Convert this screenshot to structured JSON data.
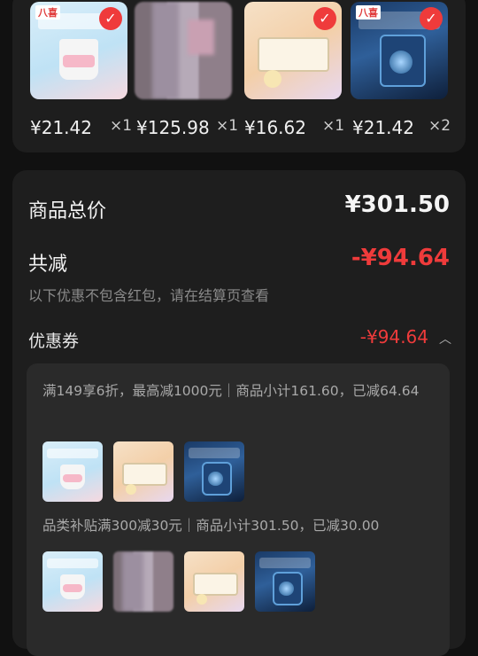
{
  "top_products": [
    {
      "price": "¥21.42",
      "qty": "×1",
      "image": "ice-cream-strawberry-tub"
    },
    {
      "price": "¥125.98",
      "qty": "×1",
      "image": "blurred-product"
    },
    {
      "price": "¥16.62",
      "qty": "×1",
      "image": "ice-cream-box"
    },
    {
      "price": "¥21.42",
      "qty": "×2",
      "image": "ice-cream-blue-tub"
    }
  ],
  "summary": {
    "total_label": "商品总价",
    "total_value": "¥301.50",
    "reduce_label": "共减",
    "reduce_value": "-¥94.64",
    "note": "以下优惠不包含红包，请在结算页查看",
    "coupon_label": "优惠券",
    "coupon_value": "-¥94.64"
  },
  "coupon_details": [
    {
      "text": "满149享6折，最高减1000元｜商品小计161.60，已减64.64"
    },
    {
      "text": "品类补贴满300减30元｜商品小计301.50，已减30.00"
    }
  ],
  "brand_logo": "八喜",
  "colors": {
    "accent_red": "#ef3b3b",
    "card_bg": "#1e1e1e",
    "page_bg": "#111111",
    "detail_bg": "#2a2a2a"
  },
  "icons": {
    "check": "check-circle-icon",
    "chevron": "chevron-up-icon"
  }
}
